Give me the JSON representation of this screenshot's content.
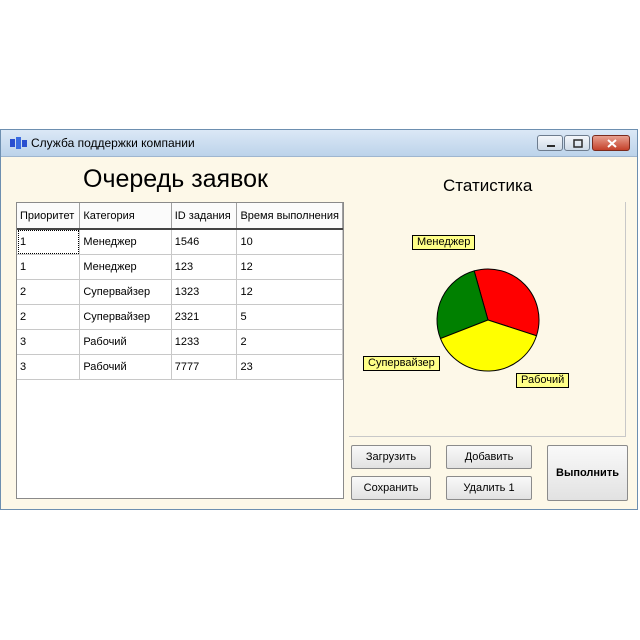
{
  "window": {
    "title": "Служба поддержки компании"
  },
  "main": {
    "title": "Очередь заявок",
    "columns": [
      "Приоритет",
      "Категория",
      "ID задания",
      "Время выполнения"
    ],
    "rows": [
      [
        "1",
        "Менеджер",
        "1546",
        "10"
      ],
      [
        "1",
        "Менеджер",
        "123",
        "12"
      ],
      [
        "2",
        "Супервайзер",
        "1323",
        "12"
      ],
      [
        "2",
        "Супервайзер",
        "2321",
        "5"
      ],
      [
        "3",
        "Рабочий",
        "1233",
        "2"
      ],
      [
        "3",
        "Рабочий",
        "7777",
        "23"
      ]
    ]
  },
  "stats": {
    "title": "Статистика",
    "chart_data": {
      "type": "pie",
      "categories": [
        "Менеджер",
        "Супервайзер",
        "Рабочий"
      ],
      "values": [
        22,
        17,
        25
      ],
      "colors": [
        "#ff0000",
        "#008000",
        "#ffff00"
      ]
    }
  },
  "buttons": {
    "load": "Загрузить",
    "add": "Добавить",
    "save": "Сохранить",
    "delete": "Удалить 1",
    "run": "Выполнить"
  }
}
